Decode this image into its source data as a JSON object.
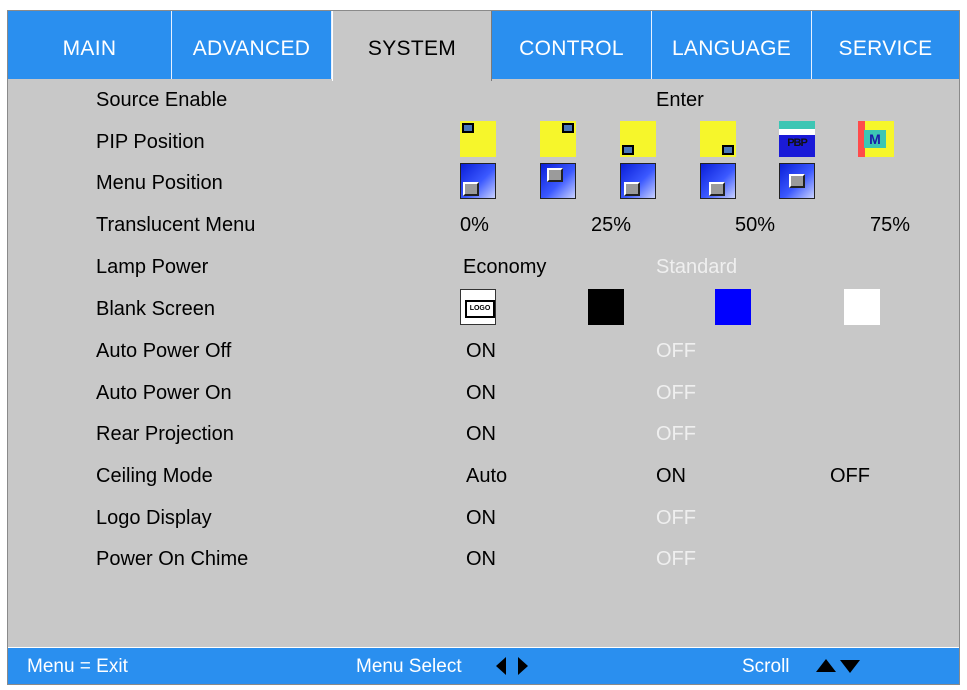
{
  "tabs": [
    {
      "label": "MAIN"
    },
    {
      "label": "ADVANCED"
    },
    {
      "label": "SYSTEM"
    },
    {
      "label": "CONTROL"
    },
    {
      "label": "LANGUAGE"
    },
    {
      "label": "SERVICE"
    }
  ],
  "active_tab": "SYSTEM",
  "rows": {
    "source_enable": {
      "label": "Source Enable",
      "value": "Enter"
    },
    "pip_position": {
      "label": "PIP Position",
      "icons": [
        "pip-top-left-icon",
        "pip-top-right-icon",
        "pip-bottom-left-icon",
        "pip-bottom-right-icon",
        "pbp-icon",
        "mosaic-icon"
      ],
      "pbp_text": "PBP",
      "mosaic_text": "M"
    },
    "menu_position": {
      "label": "Menu Position",
      "icons": [
        "menu-bottom-left-icon",
        "menu-top-left-icon",
        "menu-bottom-center-icon",
        "menu-bottom-right-icon",
        "menu-center-icon"
      ]
    },
    "translucent_menu": {
      "label": "Translucent Menu",
      "options": [
        "0%",
        "25%",
        "50%",
        "75%"
      ]
    },
    "lamp_power": {
      "label": "Lamp Power",
      "options": [
        "Economy",
        "Standard"
      ],
      "selected": "Economy"
    },
    "blank_screen": {
      "label": "Blank Screen",
      "logo_text": "LOGO",
      "colors": [
        "#000000",
        "#0000ff",
        "#ffffff"
      ]
    },
    "auto_power_off": {
      "label": "Auto Power Off",
      "options": [
        "ON",
        "OFF"
      ],
      "selected": "ON"
    },
    "auto_power_on": {
      "label": "Auto Power On",
      "options": [
        "ON",
        "OFF"
      ],
      "selected": "ON"
    },
    "rear_projection": {
      "label": "Rear Projection",
      "options": [
        "ON",
        "OFF"
      ],
      "selected": "ON"
    },
    "ceiling_mode": {
      "label": "Ceiling Mode",
      "options": [
        "Auto",
        "ON",
        "OFF"
      ]
    },
    "logo_display": {
      "label": "Logo Display",
      "options": [
        "ON",
        "OFF"
      ],
      "selected": "ON"
    },
    "power_on_chime": {
      "label": "Power On Chime",
      "options": [
        "ON",
        "OFF"
      ],
      "selected": "ON"
    }
  },
  "footer": {
    "exit": "Menu = Exit",
    "select": "Menu Select",
    "scroll": "Scroll"
  },
  "colors": {
    "accent": "#2a8fef",
    "panel": "#c8c8c8",
    "inactive_option": "#efefef"
  }
}
